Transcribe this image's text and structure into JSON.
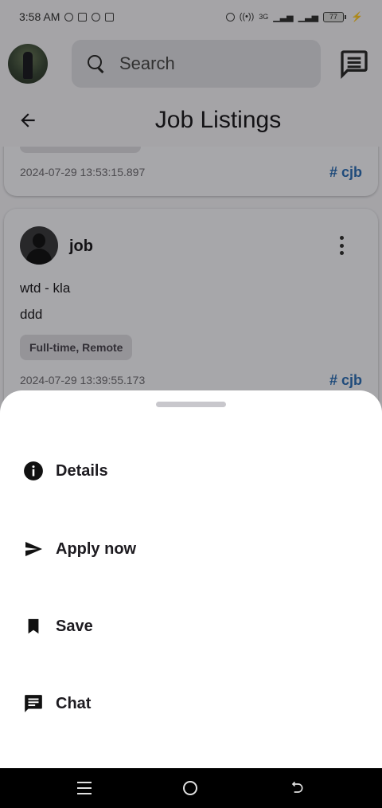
{
  "status_bar": {
    "time": "3:58 AM",
    "network_labels": "3G",
    "battery_level": "77"
  },
  "header": {
    "search_placeholder": "Search"
  },
  "title_bar": {
    "title": "Job Listings"
  },
  "feed": {
    "card1": {
      "timestamp": "2024-07-29 13:53:15.897",
      "hashtag": "# cjb"
    },
    "card2": {
      "poster": "job",
      "line1": "wtd - kla",
      "line2": "ddd",
      "tag": "Full-time, Remote",
      "timestamp": "2024-07-29 13:39:55.173",
      "hashtag": "# cjb"
    }
  },
  "sheet": {
    "items": [
      {
        "label": "Details",
        "icon": "info-icon"
      },
      {
        "label": "Apply now",
        "icon": "send-icon"
      },
      {
        "label": "Save",
        "icon": "bookmark-icon"
      },
      {
        "label": "Chat",
        "icon": "chat-icon"
      }
    ]
  },
  "colors": {
    "accent": "#2f6fb5",
    "sheet_bg": "#ffffff",
    "scrim": "#000000"
  }
}
